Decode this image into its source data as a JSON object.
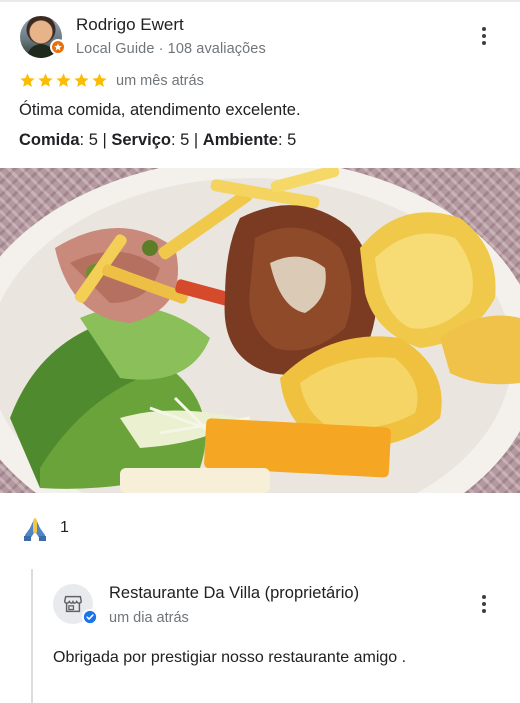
{
  "review": {
    "reviewer_name": "Rodrigo Ewert",
    "reviewer_meta": "Local Guide · 108 avaliações",
    "avatar_icon": "reviewer-avatar",
    "badge_icon": "local-guide-badge-icon",
    "rating": 5,
    "max_rating": 5,
    "star_color": "#fbbc04",
    "time": "um mês atrás",
    "text": "Ótima comida, atendimento excelente.",
    "sub_ratings": [
      {
        "label": "Comida",
        "value": "5"
      },
      {
        "label": "Serviço",
        "value": "5"
      },
      {
        "label": "Ambiente",
        "value": "5"
      }
    ],
    "photo_icon": "review-photo"
  },
  "reactions": {
    "icon": "folded-hands-icon",
    "count": "1"
  },
  "reply": {
    "owner_name": "Restaurante Da Villa (proprietário)",
    "time": "um dia atrás",
    "text": "Obrigada por prestigiar nosso restaurante amigo .",
    "avatar_icon": "storefront-icon",
    "verified_icon": "verified-icon",
    "verified_color": "#1a73e8"
  },
  "colors": {
    "primary_text": "#202124",
    "secondary_text": "#70757a",
    "guide_badge": "#e8710a"
  }
}
